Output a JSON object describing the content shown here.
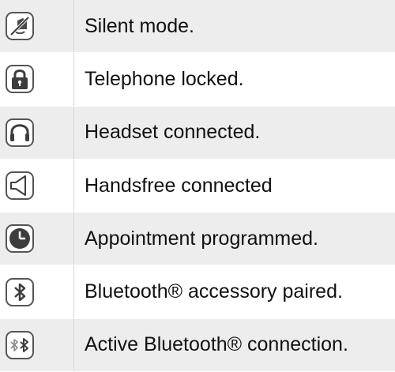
{
  "rows": [
    {
      "icon": "silent-mode-icon",
      "label": "Silent mode."
    },
    {
      "icon": "lock-icon",
      "label": "Telephone locked."
    },
    {
      "icon": "headset-icon",
      "label": "Headset connected."
    },
    {
      "icon": "handsfree-speaker-icon",
      "label": "Handsfree connected"
    },
    {
      "icon": "clock-icon",
      "label": "Appointment programmed."
    },
    {
      "icon": "bluetooth-icon",
      "label": "Bluetooth® accessory paired."
    },
    {
      "icon": "bluetooth-active-icon",
      "label": "Active Bluetooth® connection."
    }
  ],
  "colors": {
    "row_shade": "#ededed",
    "icon_fill": "#3d3d3d",
    "icon_border": "#555555"
  }
}
